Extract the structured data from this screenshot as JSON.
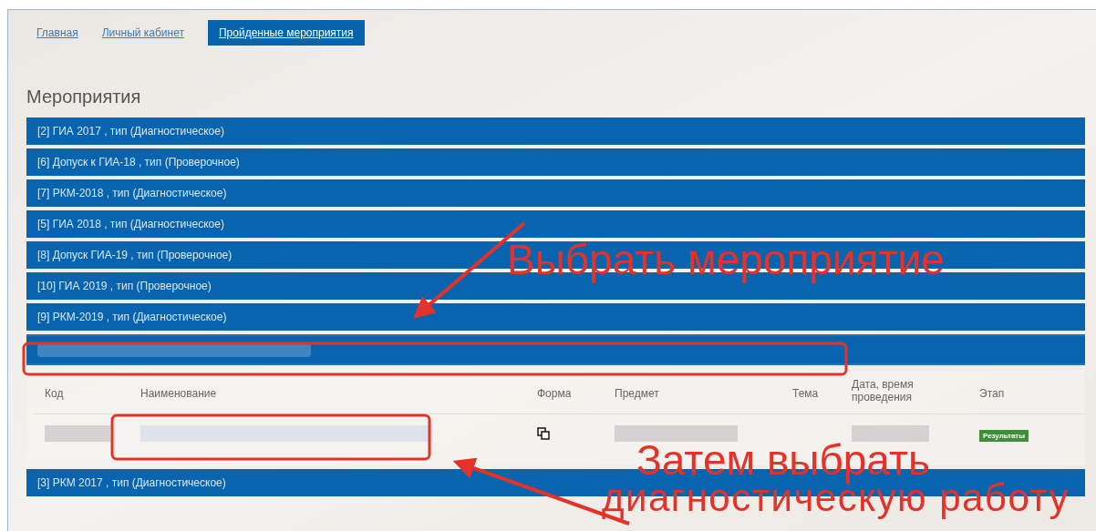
{
  "nav": [
    {
      "label": "Главная",
      "selected": false
    },
    {
      "label": "Личный кабинет",
      "selected": false
    },
    {
      "label": "Пройденные мероприятия",
      "selected": true
    }
  ],
  "heading": "Мероприятия",
  "events": [
    {
      "kind": "text",
      "label": "[2] ГИА 2017 , тип (Диагностическое)",
      "expanded": false
    },
    {
      "kind": "text",
      "label": "[6] Допуск к ГИА-18 , тип (Проверочное)",
      "expanded": false
    },
    {
      "kind": "text",
      "label": "[7] РКМ-2018 , тип (Диагностическое)",
      "expanded": false
    },
    {
      "kind": "text",
      "label": "[5] ГИА 2018 , тип (Диагностическое)",
      "expanded": false
    },
    {
      "kind": "text",
      "label": "[8] Допуск ГИА-19 , тип (Проверочное)",
      "expanded": false
    },
    {
      "kind": "text",
      "label": "[10] ГИА 2019 , тип (Проверочное)",
      "expanded": false
    },
    {
      "kind": "text",
      "label": "[9] РКМ-2019 , тип (Диагностическое)",
      "expanded": false
    },
    {
      "kind": "blurred",
      "expanded": true
    },
    {
      "kind": "text",
      "label": "[3] РКМ 2017 , тип (Диагностическое)",
      "expanded": false
    }
  ],
  "table": {
    "columns": [
      "Код",
      "Наименование",
      "Форма",
      "Предмет",
      "Тема",
      "Дата, время проведения",
      "Этап"
    ],
    "rows": [
      [
        {
          "kind": "blurred"
        },
        {
          "kind": "blurred"
        },
        {
          "kind": "icon"
        },
        {
          "kind": "blurred"
        },
        {
          "kind": "empty"
        },
        {
          "kind": "blurred"
        },
        {
          "kind": "badge",
          "text": "Результаты"
        }
      ]
    ]
  },
  "annotations": [
    {
      "text": "Выбрать мероприятие"
    },
    {
      "text": "Затем выбрать"
    },
    {
      "text": "диагностическую работу"
    }
  ]
}
